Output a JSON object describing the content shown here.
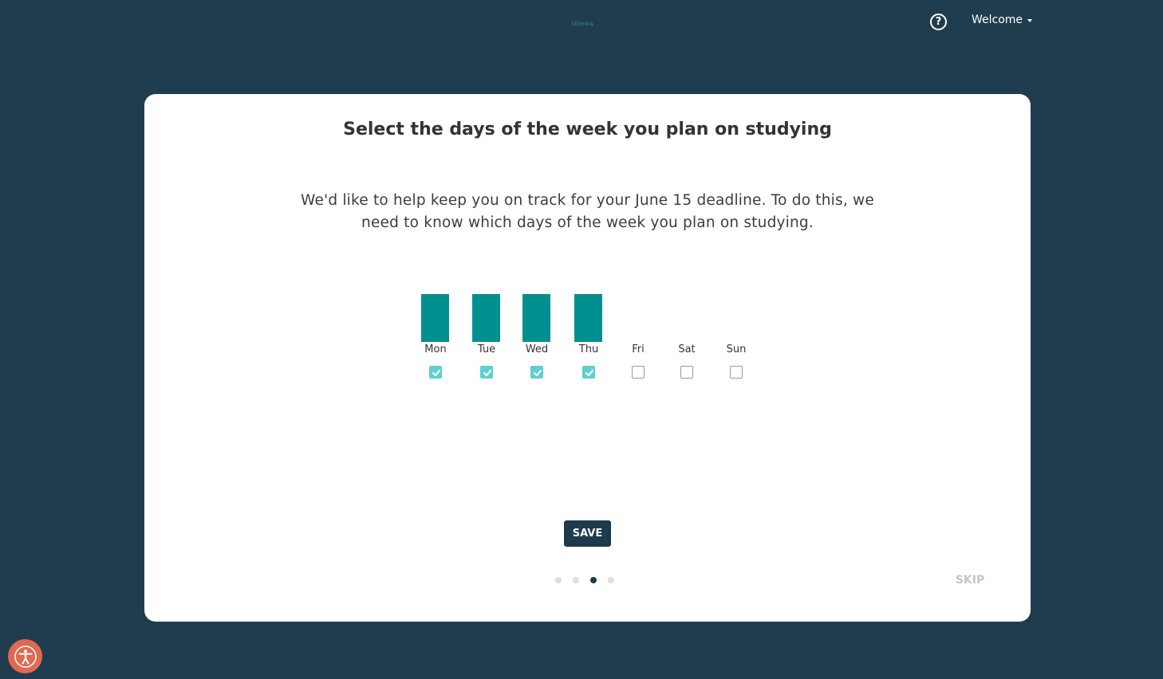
{
  "header": {
    "logo_text": "CEimitra",
    "help_icon": "question-circle-icon",
    "welcome_label": "Welcome"
  },
  "card": {
    "title": "Select the days of the week you plan on studying",
    "description": "We'd like to help keep you on track for your June 15 deadline. To do this, we need to know which days of the week you plan on studying.",
    "days": [
      {
        "label": "Mon",
        "checked": true
      },
      {
        "label": "Tue",
        "checked": true
      },
      {
        "label": "Wed",
        "checked": true
      },
      {
        "label": "Thu",
        "checked": true
      },
      {
        "label": "Fri",
        "checked": false
      },
      {
        "label": "Sat",
        "checked": false
      },
      {
        "label": "Sun",
        "checked": false
      }
    ],
    "save_label": "SAVE",
    "skip_label": "SKIP",
    "pagination": {
      "total": 4,
      "current": 3
    }
  },
  "colors": {
    "background": "#203d4f",
    "bar": "#008f8f",
    "checkbox_checked": "#5fcfd0",
    "save_button": "#1e3a4d",
    "accessibility_button": "#e0694f"
  },
  "accessibility": {
    "icon": "accessibility-person-icon"
  }
}
